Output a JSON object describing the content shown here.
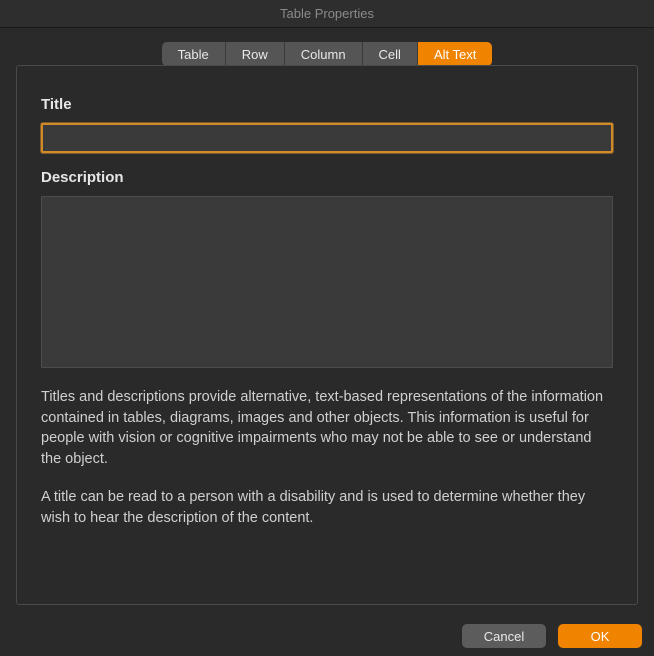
{
  "window": {
    "title": "Table Properties"
  },
  "tabs": {
    "table": "Table",
    "row": "Row",
    "column": "Column",
    "cell": "Cell",
    "alt_text": "Alt Text"
  },
  "form": {
    "title_label": "Title",
    "title_value": "",
    "description_label": "Description",
    "description_value": ""
  },
  "help": {
    "p1": "Titles and descriptions provide alternative, text-based representations of the information contained in tables, diagrams, images and other objects. This information is useful for people with vision or cognitive impairments who may not be able to see or understand the object.",
    "p2": "A title can be read to a person with a disability and is used to determine whether they wish to hear the description of the content."
  },
  "buttons": {
    "cancel": "Cancel",
    "ok": "OK"
  }
}
